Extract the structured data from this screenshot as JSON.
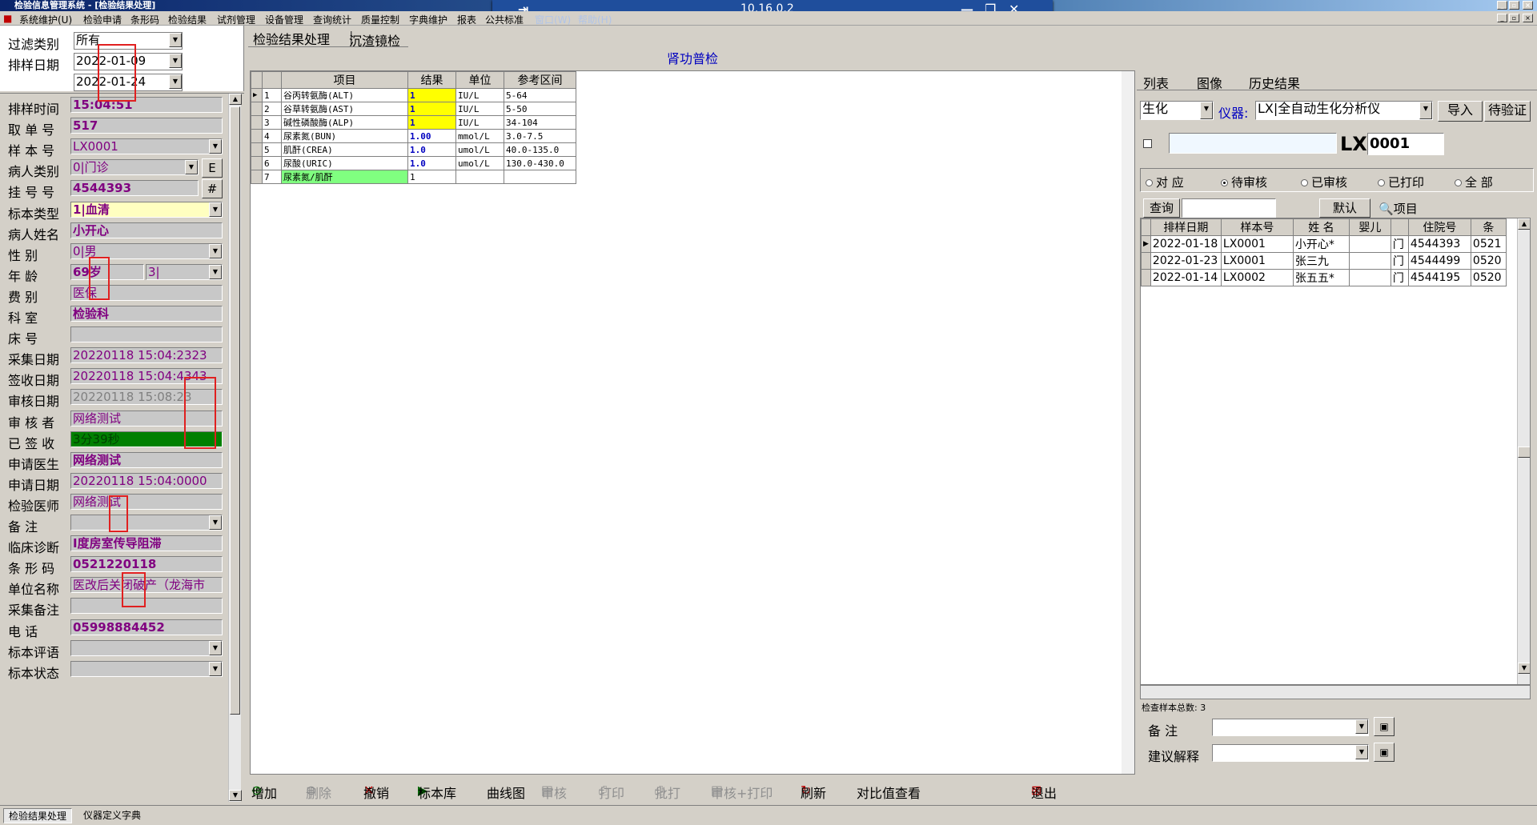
{
  "window": {
    "title": "检验信息管理系统 - [检验结果处理]",
    "remote_ip": "10.16.0.2"
  },
  "menu": [
    "系统维护(U)",
    "检验申请",
    "条形码",
    "检验结果",
    "试剂管理",
    "设备管理",
    "查询统计",
    "质量控制",
    "字典维护",
    "报表",
    "公共标准",
    "窗口(W)",
    "帮助(H)"
  ],
  "filter": {
    "type_label": "过滤类别",
    "type_value": "所有",
    "date_label": "排样日期",
    "date_from": "2022-01-09",
    "date_to": "2022-01-24"
  },
  "form": {
    "fields": [
      {
        "label": "排样时间",
        "value": "15:04:51"
      },
      {
        "label": "取 单 号",
        "value": "517"
      },
      {
        "label": "样 本 号",
        "value": "LX0001"
      },
      {
        "label": "病人类别",
        "value": "0|门诊",
        "btn": "E"
      },
      {
        "label": "挂 号 号",
        "value": "4544393",
        "btn": "#"
      },
      {
        "label": "标本类型",
        "value": "1|血清"
      },
      {
        "label": "病人姓名",
        "value": "小开心"
      },
      {
        "label": "性    别",
        "value": "0|男"
      },
      {
        "label": "年    龄",
        "value": "69岁",
        "value2": "3|"
      },
      {
        "label": "费    别",
        "value": "医保"
      },
      {
        "label": "科    室",
        "value": "检验科"
      },
      {
        "label": "床    号",
        "value": ""
      },
      {
        "label": "采集日期",
        "value": "20220118 15:04:2323"
      },
      {
        "label": "签收日期",
        "value": "20220118 15:04:4343"
      },
      {
        "label": "审核日期",
        "value": "20220118 15:08:23"
      },
      {
        "label": "审 核 者",
        "value": "网络测试"
      },
      {
        "label": "已 签 收",
        "value": "3分39秒"
      },
      {
        "label": "申请医生",
        "value": "网络测试"
      },
      {
        "label": "申请日期",
        "value": "20220118 15:04:0000"
      },
      {
        "label": "检验医师",
        "value": "网络测试"
      },
      {
        "label": "备    注",
        "value": ""
      },
      {
        "label": "临床诊断",
        "value": "Ⅰ度房室传导阻滞"
      },
      {
        "label": "条 形 码",
        "value": "0521220118"
      },
      {
        "label": "单位名称",
        "value": "医改后关闭破产（龙海市"
      },
      {
        "label": "采集备注",
        "value": ""
      },
      {
        "label": "电    话",
        "value": "05998884452"
      },
      {
        "label": "标本评语",
        "value": ""
      },
      {
        "label": "标本状态",
        "value": ""
      }
    ]
  },
  "tabs": {
    "main": [
      "检验结果处理",
      "沉渣镜检"
    ],
    "right": [
      "列表",
      "图像",
      "历史结果"
    ]
  },
  "result_title": "肾功普检",
  "results": {
    "headers": [
      "项目",
      "结果",
      "单位",
      "参考区间"
    ],
    "rows": [
      {
        "no": "1",
        "item": "谷丙转氨酶(ALT)",
        "result": "1",
        "unit": "IU/L",
        "ref": "5-64"
      },
      {
        "no": "2",
        "item": "谷草转氨酶(AST)",
        "result": "1",
        "unit": "IU/L",
        "ref": "5-50"
      },
      {
        "no": "3",
        "item": "碱性磷酸酶(ALP)",
        "result": "1",
        "unit": "IU/L",
        "ref": "34-104"
      },
      {
        "no": "4",
        "item": "尿素氮(BUN)",
        "result": "1.00",
        "unit": "mmol/L",
        "ref": "3.0-7.5"
      },
      {
        "no": "5",
        "item": "肌酐(CREA)",
        "result": "1.0",
        "unit": "umol/L",
        "ref": "40.0-135.0"
      },
      {
        "no": "6",
        "item": "尿酸(URIC)",
        "result": "1.0",
        "unit": "umol/L",
        "ref": "130.0-430.0"
      },
      {
        "no": "7",
        "item": "尿素氮/肌酐",
        "result": "1",
        "unit": "",
        "ref": ""
      }
    ]
  },
  "right": {
    "category": "生化",
    "instrument_label": "仪器:",
    "instrument": "LX|全自动生化分析仪",
    "import_btn": "导入",
    "pending_btn": "待验证",
    "prefix": "LX",
    "sample_no": "0001",
    "radios": [
      "对 应",
      "待审核",
      "已审核",
      "已打印",
      "全 部"
    ],
    "query_btn": "查询",
    "default_btn": "默认",
    "item_label": "项目",
    "list_headers": [
      "排样日期",
      "样本号",
      "姓 名",
      "婴儿",
      "",
      "住院号",
      "条"
    ],
    "list_rows": [
      [
        "2022-01-18",
        "LX0001",
        "小开心*",
        "",
        "门",
        "4544393",
        "0521"
      ],
      [
        "2022-01-23",
        "LX0001",
        "张三九",
        "",
        "门",
        "4544499",
        "0520"
      ],
      [
        "2022-01-14",
        "LX0002",
        "张五五*",
        "",
        "门",
        "4544195",
        "0520"
      ]
    ],
    "total": "检查样本总数: 3",
    "remark_label": "备    注",
    "advice_label": "建议解释"
  },
  "toolbar": [
    "增加",
    "删除",
    "撤销",
    "标本库",
    "曲线图",
    "审核",
    "打印",
    "批打",
    "审核+打印",
    "刷新",
    "对比值查看",
    "退出"
  ],
  "status": [
    "检验结果处理",
    "仪器定义字典"
  ]
}
